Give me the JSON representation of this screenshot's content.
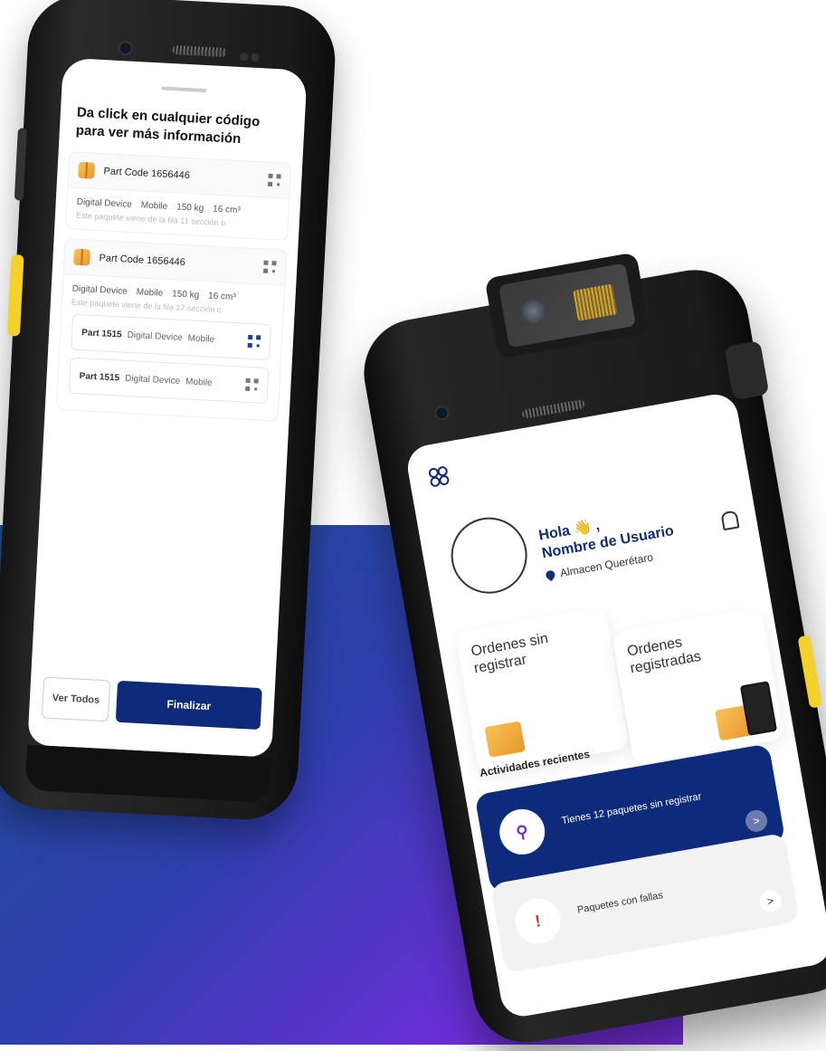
{
  "left_device": {
    "instruction": "Da click en cualquier código para ver más información",
    "cards": [
      {
        "title": "Part Code 1656446",
        "specs": [
          "Digital Device",
          "Mobile",
          "150 kg",
          "16 cm³"
        ],
        "description": "Este paquete viene de la fila 11 sección b"
      },
      {
        "title": "Part Code 1656446",
        "specs": [
          "Digital Device",
          "Mobile",
          "150 kg",
          "16 cm³"
        ],
        "description": "Este paquete viene de la fila 17 sección c",
        "parts": [
          {
            "code": "Part 1515",
            "device": "Digital Device",
            "type": "Mobile"
          },
          {
            "code": "Part 1515",
            "device": "Digital Device",
            "type": "Mobile"
          }
        ]
      }
    ],
    "actions": {
      "see_all": "Ver Todos",
      "finish": "Finalizar"
    }
  },
  "right_device": {
    "greeting": "Hola 👋 ,",
    "user_name": "Nombre de Usuario",
    "location": "Almacen Querétaro",
    "tiles": [
      {
        "label": "Ordenes sin registrar"
      },
      {
        "label": "Ordenes registradas"
      }
    ],
    "recent_title": "Actividades recientes",
    "activities": [
      {
        "text": "Tienes 12 paquetes sin registrar",
        "arrow": ">"
      },
      {
        "text": "Paquetes con fallas",
        "arrow": ">"
      }
    ]
  },
  "colors": {
    "primary": "#0d2b7a",
    "accent_yellow": "#f3d02a",
    "gradient_start": "#1d4f97",
    "gradient_end": "#7a2ee0"
  }
}
